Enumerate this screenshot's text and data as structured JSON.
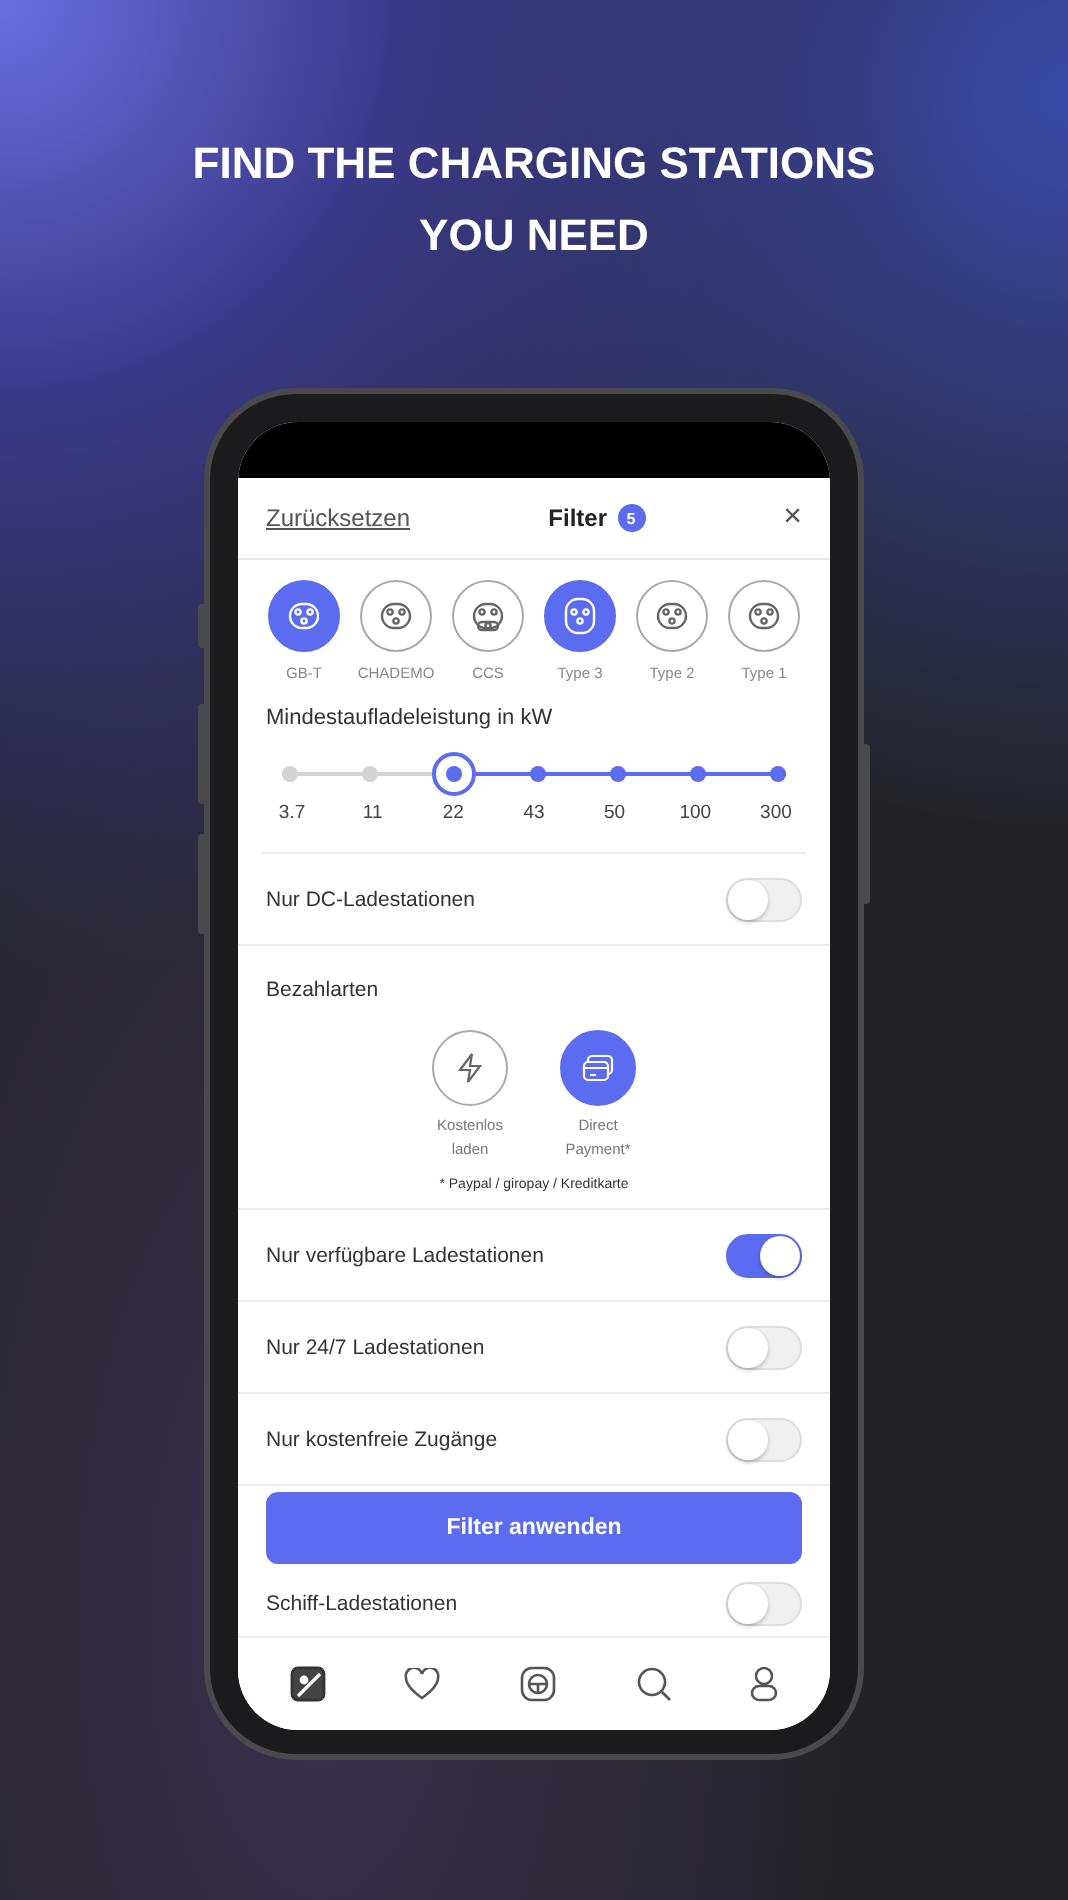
{
  "headline": "FIND THE CHARGING STATIONS YOU NEED",
  "header": {
    "reset": "Zurücksetzen",
    "title": "Filter",
    "count": "5",
    "close": "×"
  },
  "connectors": [
    {
      "label": "GB-T",
      "selected": true
    },
    {
      "label": "CHADEMO",
      "selected": false
    },
    {
      "label": "CCS",
      "selected": false
    },
    {
      "label": "Type 3",
      "selected": true
    },
    {
      "label": "Type 2",
      "selected": false
    },
    {
      "label": "Type 1",
      "selected": false
    }
  ],
  "power": {
    "title": "Mindestaufladeleistung in kW",
    "stops": [
      {
        "label": "3.7",
        "selected": false
      },
      {
        "label": "11",
        "selected": false
      },
      {
        "label": "22",
        "selected": true
      },
      {
        "label": "43",
        "selected": false
      },
      {
        "label": "50",
        "selected": false
      },
      {
        "label": "100",
        "selected": false
      },
      {
        "label": "300",
        "selected": false
      }
    ]
  },
  "dc_toggle": {
    "label": "Nur DC-Ladestationen",
    "on": false
  },
  "payment": {
    "title": "Bezahlarten",
    "options": [
      {
        "kind": "free",
        "label": "Kostenlos laden",
        "selected": false
      },
      {
        "kind": "card",
        "label": "Direct Payment*",
        "selected": true
      }
    ],
    "note": "* Paypal / giropay / Kreditkarte"
  },
  "toggles": [
    {
      "label": "Nur verfügbare Ladestationen",
      "on": true
    },
    {
      "label": "Nur 24/7 Ladestationen",
      "on": false
    },
    {
      "label": "Nur kostenfreie Zugänge",
      "on": false
    },
    {
      "label": "Schiff-Ladestationen",
      "on": false
    }
  ],
  "apply_button": "Filter anwenden",
  "nav": [
    {
      "kind": "map",
      "selected": true
    },
    {
      "kind": "heart",
      "selected": false
    },
    {
      "kind": "wheel",
      "selected": false
    },
    {
      "kind": "search",
      "selected": false
    },
    {
      "kind": "profile",
      "selected": false
    }
  ]
}
